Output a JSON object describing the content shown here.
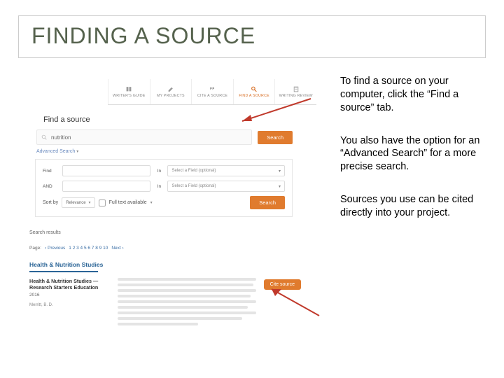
{
  "title": "FINDING A SOURCE",
  "side": {
    "p1": "To find a source on your computer, click the “Find a source” tab.",
    "p2": "You also have the option for an “Advanced Search” for a more precise search.",
    "p3": "Sources you use can be cited directly into your project."
  },
  "nav": {
    "items": [
      {
        "label": "WRITER'S GUIDE",
        "icon": "book-icon"
      },
      {
        "label": "MY PROJECTS",
        "icon": "pencil-icon"
      },
      {
        "label": "CITE A SOURCE",
        "icon": "quote-icon"
      },
      {
        "label": "FIND A SOURCE",
        "icon": "search-icon"
      },
      {
        "label": "WRITING REVIEW",
        "icon": "doc-icon"
      }
    ]
  },
  "find": {
    "heading": "Find a source",
    "query": "nutrition",
    "search_btn": "Search",
    "advanced_link": "Advanced Search",
    "adv": {
      "row1_label": "Find",
      "row2_label": "AND",
      "in_label": "In",
      "field_placeholder": "Select a Field (optional)",
      "sortby_label": "Sort by",
      "sortby_value": "Relevance",
      "fulltext_label": "Full text available",
      "search_btn": "Search"
    }
  },
  "results": {
    "label": "Search results",
    "page_label": "Page:",
    "prev": "Previous",
    "pages": "1  2  3  4  5  6  7  8  9  10",
    "next": "Next",
    "topic": "Health & Nutrition Studies",
    "card": {
      "title": "Health & Nutrition Studies — Research Starters Education",
      "year": "2016",
      "author": "Merritt, B. D.",
      "cite_btn": "Cite source"
    }
  }
}
